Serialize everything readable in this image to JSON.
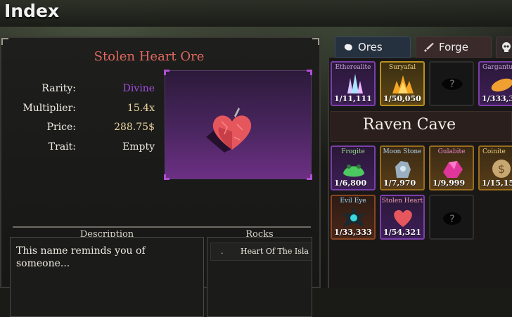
{
  "header": {
    "title": "Index"
  },
  "item": {
    "name": "Stolen Heart Ore",
    "stats": [
      {
        "label": "Rarity:",
        "value": "Divine",
        "color": "#a24ee0"
      },
      {
        "label": "Multiplier:",
        "value": "15.4x",
        "color": "#e8d4a0"
      },
      {
        "label": "Price:",
        "value": "288.75$",
        "color": "#e8d4a0"
      },
      {
        "label": "Trait:",
        "value": "Empty",
        "color": "#e8e4da"
      }
    ],
    "description_label": "Description",
    "description": "This name reminds you of someone...",
    "rocks_label": "Rocks",
    "rocks": [
      {
        "bullet": ".",
        "name": "Heart Of The Isla"
      }
    ]
  },
  "tabs": [
    {
      "label": "Ores",
      "icon": "ore-icon",
      "active": true
    },
    {
      "label": "Forge",
      "icon": "sword-icon",
      "active": false
    },
    {
      "label": "",
      "icon": "skull-icon",
      "active": false
    }
  ],
  "collection": {
    "row1": [
      {
        "name": "Etherealite",
        "count": "1/11,111",
        "rarity": "divine",
        "icon": "crystal-icon",
        "name_color": "#c9a6e0"
      },
      {
        "name": "Suryafal",
        "count": "1/50,050",
        "rarity": "legend",
        "icon": "sun-flame-icon",
        "name_color": "#f3d07a"
      },
      {
        "name": "",
        "count": "",
        "rarity": "unknown",
        "icon": "unknown-ore-icon",
        "name_color": "#999"
      },
      {
        "name": "Gargantu",
        "count": "1/333,3",
        "rarity": "divine",
        "icon": "orange-gem-icon",
        "name_color": "#c9a6e0"
      }
    ],
    "cave_name": "Raven Cave",
    "row2": [
      {
        "name": "Frogite",
        "count": "1/6,800",
        "rarity": "divine",
        "icon": "frog-ore-icon",
        "name_color": "#9fe08a"
      },
      {
        "name": "Moon Stone",
        "count": "1/7,970",
        "rarity": "uncommon",
        "icon": "moon-stone-icon",
        "name_color": "#b8d6f0"
      },
      {
        "name": "Gulabite",
        "count": "1/9,999",
        "rarity": "uncommon",
        "icon": "pink-ore-icon",
        "name_color": "#f08ad0"
      },
      {
        "name": "Coinite",
        "count": "1/15,15",
        "rarity": "uncommon",
        "icon": "coin-ore-icon",
        "name_color": "#f3d07a"
      }
    ],
    "row3": [
      {
        "name": "Evil Eye",
        "count": "1/33,333",
        "rarity": "rare",
        "icon": "evil-eye-icon",
        "name_color": "#9bd8ff"
      },
      {
        "name": "Stolen Heart",
        "count": "1/54,321",
        "rarity": "divine",
        "icon": "heart-ore-icon",
        "name_color": "#f0a0b0"
      },
      {
        "name": "",
        "count": "",
        "rarity": "unknown",
        "icon": "unknown-ore-icon",
        "name_color": "#999"
      }
    ]
  }
}
